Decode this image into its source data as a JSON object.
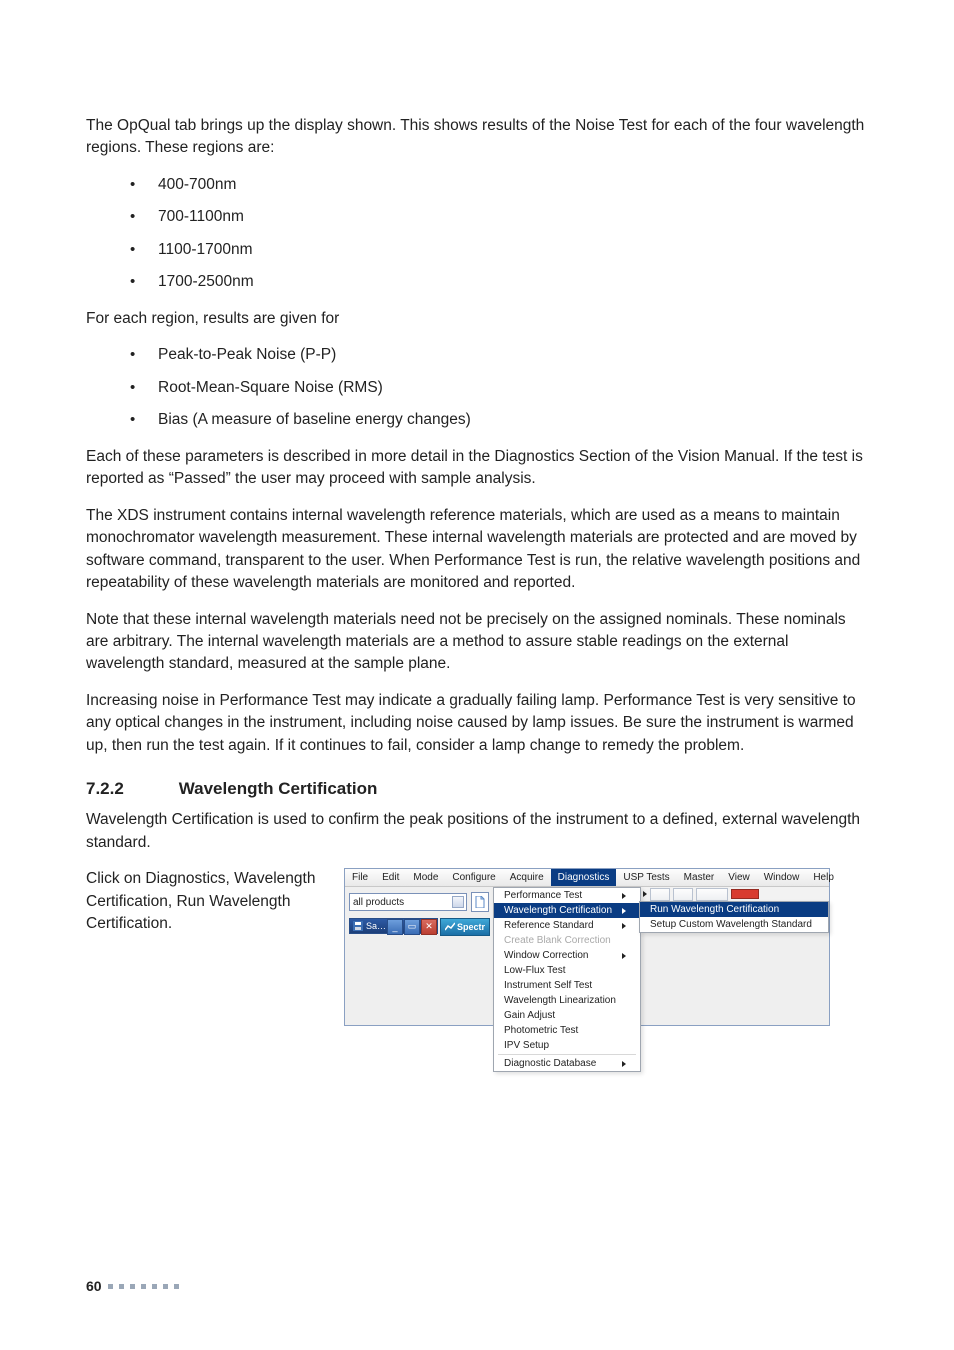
{
  "body": {
    "p1": "The OpQual tab brings up the display shown. This shows results of the Noise Test for each of the four wavelength regions. These regions are:",
    "regions": [
      "400-700nm",
      "700-1100nm",
      "1100-1700nm",
      "1700-2500nm"
    ],
    "p2": "For each region, results are given for",
    "metrics": [
      "Peak-to-Peak Noise (P-P)",
      "Root-Mean-Square Noise (RMS)",
      "Bias (A measure of baseline energy changes)"
    ],
    "p3": "Each of these parameters is described in more detail in the Diagnostics Section of the Vision Manual. If the test is reported as “Passed” the user may proceed with sample analysis.",
    "p4": "The XDS instrument contains internal wavelength reference materials, which are used as a means to maintain monochromator wavelength measurement. These internal wavelength materials are protected and are moved by software command, transparent to the user. When Performance Test is run, the relative wavelength positions and repeatability of these wavelength materials are monitored and reported.",
    "p5": "Note that these internal wavelength materials need not be precisely on the assigned nominals. These nominals are arbitrary. The internal wavelength materials are a method to assure stable readings on the external wavelength standard, measured at the sample plane.",
    "p6": "Increasing noise in Performance Test may indicate a gradually failing lamp. Performance Test is very sensitive to any optical changes in the instrument, including noise caused by lamp issues. Be sure the instrument is warmed up, then run the test again. If it continues to fail, consider a lamp change to remedy the problem."
  },
  "section": {
    "num": "7.2.2",
    "title": "Wavelength Certification",
    "p1": "Wavelength Certification is used to confirm the peak positions of the instrument to a defined, external wavelength standard.",
    "side": "Click on Diagnostics, Wavelength Certification, Run Wavelength Certification."
  },
  "app": {
    "menu": [
      "File",
      "Edit",
      "Mode",
      "Configure",
      "Acquire",
      "Diagnostics",
      "USP Tests",
      "Master",
      "View",
      "Window",
      "Help"
    ],
    "selected_menu_index": 5,
    "combo_value": "all products",
    "child_titlebar": "Sa…",
    "spectr_label": "Spectr",
    "dropdown": {
      "items": [
        {
          "label": "Performance Test",
          "arrow": true
        },
        {
          "label": "Wavelength Certification",
          "arrow": true,
          "selected": true
        },
        {
          "label": "Reference Standard",
          "arrow": true
        },
        {
          "label": "Create Blank Correction",
          "disabled": true
        },
        {
          "label": "Window Correction",
          "arrow": true
        },
        {
          "label": "Low-Flux Test"
        },
        {
          "label": "Instrument Self Test"
        },
        {
          "label": "Wavelength Linearization"
        },
        {
          "label": "Gain Adjust"
        },
        {
          "label": "Photometric Test"
        },
        {
          "label": "IPV Setup"
        },
        {
          "separator": true
        },
        {
          "label": "Diagnostic Database",
          "arrow": true
        }
      ]
    },
    "submenu": {
      "items": [
        {
          "label": "Run Wavelength Certification",
          "selected": true
        },
        {
          "label": "Setup Custom Wavelength Standard"
        }
      ]
    }
  },
  "footer": {
    "page": "60"
  }
}
